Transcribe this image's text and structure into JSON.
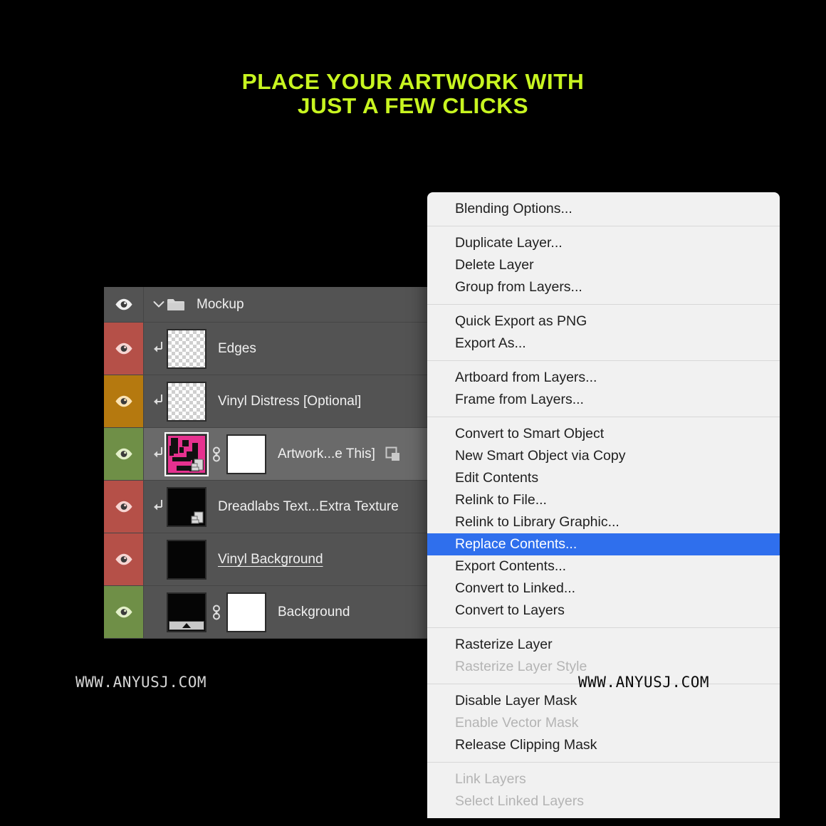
{
  "headline": {
    "line1": "PLACE YOUR ARTWORK WITH",
    "line2": "JUST A FEW CLICKS",
    "color": "#c8f520"
  },
  "watermarks": {
    "left": "WWW.ANYUSJ.COM",
    "right": "WWW.ANYUSJ.COM"
  },
  "layers_panel": {
    "rows": [
      {
        "name": "Mockup",
        "type": "group",
        "swatch": "#535353",
        "eye_color": "#f0f0f0",
        "selected": false
      },
      {
        "name": "Edges",
        "type": "layer",
        "swatch": "#b55048",
        "eye_color": "#f6d5d2",
        "clipped": true,
        "thumb": "checker",
        "selected": false
      },
      {
        "name": "Vinyl Distress [Optional]",
        "type": "layer",
        "swatch": "#b5790f",
        "eye_color": "#fbe3b4",
        "clipped": true,
        "thumb": "checker",
        "selected": false
      },
      {
        "name": "Artwork...e This]",
        "type": "smart-object",
        "swatch": "#6f8f47",
        "eye_color": "#e3f0c9",
        "clipped": true,
        "thumb": "artwork",
        "has_mask": true,
        "has_link": true,
        "selected": true
      },
      {
        "name": "Dreadlabs Text...Extra Texture",
        "type": "smart-object",
        "swatch": "#b55048",
        "eye_color": "#f6d5d2",
        "clipped": true,
        "thumb": "black",
        "selected": false
      },
      {
        "name": "Vinyl Background",
        "type": "layer",
        "swatch": "#b55048",
        "eye_color": "#f6d5d2",
        "clipped": false,
        "thumb": "black",
        "underlined": true,
        "selected": false
      },
      {
        "name": "Background",
        "type": "layer",
        "swatch": "#6f8f47",
        "eye_color": "#e3f0c9",
        "clipped": false,
        "thumb": "gradient-black",
        "has_mask": true,
        "has_link": true,
        "selected": false
      }
    ]
  },
  "context_menu": {
    "highlight_color": "#2f6fed",
    "background_color": "#f1f1f1",
    "sections": [
      {
        "items": [
          {
            "label": "Blending Options...",
            "state": "enabled"
          }
        ]
      },
      {
        "items": [
          {
            "label": "Duplicate Layer...",
            "state": "enabled"
          },
          {
            "label": "Delete Layer",
            "state": "enabled"
          },
          {
            "label": "Group from Layers...",
            "state": "enabled"
          }
        ]
      },
      {
        "items": [
          {
            "label": "Quick Export as PNG",
            "state": "enabled"
          },
          {
            "label": "Export As...",
            "state": "enabled"
          }
        ]
      },
      {
        "items": [
          {
            "label": "Artboard from Layers...",
            "state": "enabled"
          },
          {
            "label": "Frame from Layers...",
            "state": "enabled"
          }
        ]
      },
      {
        "items": [
          {
            "label": "Convert to Smart Object",
            "state": "enabled"
          },
          {
            "label": "New Smart Object via Copy",
            "state": "enabled"
          },
          {
            "label": "Edit Contents",
            "state": "enabled"
          },
          {
            "label": "Relink to File...",
            "state": "enabled"
          },
          {
            "label": "Relink to Library Graphic...",
            "state": "enabled"
          },
          {
            "label": "Replace Contents...",
            "state": "highlighted"
          },
          {
            "label": "Export Contents...",
            "state": "enabled"
          },
          {
            "label": "Convert to Linked...",
            "state": "enabled"
          },
          {
            "label": "Convert to Layers",
            "state": "enabled"
          }
        ]
      },
      {
        "items": [
          {
            "label": "Rasterize Layer",
            "state": "enabled"
          },
          {
            "label": "Rasterize Layer Style",
            "state": "disabled"
          }
        ]
      },
      {
        "items": [
          {
            "label": "Disable Layer Mask",
            "state": "enabled"
          },
          {
            "label": "Enable Vector Mask",
            "state": "disabled"
          },
          {
            "label": "Release Clipping Mask",
            "state": "enabled"
          }
        ]
      },
      {
        "items": [
          {
            "label": "Link Layers",
            "state": "disabled"
          },
          {
            "label": "Select Linked Layers",
            "state": "disabled"
          }
        ]
      }
    ]
  }
}
